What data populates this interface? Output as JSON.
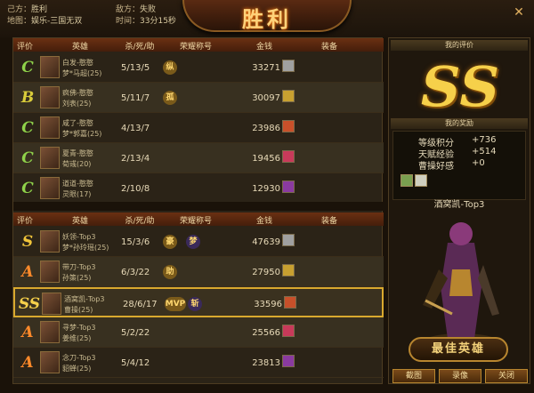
{
  "header": {
    "own_label": "己方：",
    "own_result": "胜利",
    "enemy_label": "敌方：",
    "enemy_result": "失败",
    "map_label": "地图：",
    "map_value": "娱乐-三国无双",
    "time_label": "时间：",
    "time_value": "33分15秒",
    "title": "胜利",
    "close": "✕"
  },
  "columns": {
    "rating": "评价",
    "hero": "英雄",
    "kda": "杀/死/助",
    "honor": "荣耀称号",
    "money": "金钱",
    "gear": "装备"
  },
  "columns2": {
    "rating": "评价",
    "hero": "英雄",
    "kda": "杀/死/助",
    "honor": "荣耀称号",
    "money": "金钱",
    "gear": "装备"
  },
  "team_a": [
    {
      "grade": "C",
      "grade_color": "#8fd24a",
      "name": "白发-憨憨",
      "hero": "梦*马超(25)",
      "kda": "5/13/5",
      "honors": [
        "纵"
      ],
      "money": "33271"
    },
    {
      "grade": "B",
      "grade_color": "#d9cc3a",
      "name": "疯佛-憨憨",
      "hero": "刘表(25)",
      "kda": "5/11/7",
      "honors": [
        "孤"
      ],
      "money": "30097"
    },
    {
      "grade": "C",
      "grade_color": "#8fd24a",
      "name": "咸了-憨憨",
      "hero": "梦*郭嘉(25)",
      "kda": "4/13/7",
      "honors": [],
      "money": "23986"
    },
    {
      "grade": "C",
      "grade_color": "#8fd24a",
      "name": "夏青-憨憨",
      "hero": "荀彧(20)",
      "kda": "2/13/4",
      "honors": [],
      "money": "19456"
    },
    {
      "grade": "C",
      "grade_color": "#8fd24a",
      "name": "道道-憨憨",
      "hero": "灵眼(17)",
      "kda": "2/10/8",
      "honors": [],
      "money": "12930"
    }
  ],
  "team_b": [
    {
      "grade": "S",
      "grade_color": "#f0c43a",
      "name": "妖领-Top3",
      "hero": "梦*孙玲瑶(25)",
      "kda": "15/3/6",
      "honors": [
        "豪",
        "梦"
      ],
      "money": "47639"
    },
    {
      "grade": "A",
      "grade_color": "#ff8a2a",
      "name": "带刀-Top3",
      "hero": "孙策(25)",
      "kda": "6/3/22",
      "honors": [
        "助"
      ],
      "money": "27950"
    },
    {
      "grade": "SS",
      "grade_color": "#f6d04a",
      "name": "酒窝凯-Top3",
      "hero": "曹操(25)",
      "kda": "28/6/17",
      "honors": [
        "MVP",
        "斩"
      ],
      "money": "33596"
    },
    {
      "grade": "A",
      "grade_color": "#ff8a2a",
      "name": "寻梦-Top3",
      "hero": "姜维(25)",
      "kda": "5/2/22",
      "honors": [],
      "money": "25566"
    },
    {
      "grade": "A",
      "grade_color": "#ff8a2a",
      "name": "念刀-Top3",
      "hero": "貂蝉(25)",
      "kda": "5/4/12",
      "honors": [],
      "money": "23813"
    }
  ],
  "right": {
    "my_rating_label": "我的评价",
    "my_rating": "SS",
    "reward_label": "我的奖励",
    "rewards": [
      {
        "label": "等级积分",
        "value": "+736"
      },
      {
        "label": "天赋经验",
        "value": "+514"
      },
      {
        "label": "曹操好感",
        "value": "+0"
      }
    ],
    "mvp_name": "酒窝凯-Top3",
    "best_label": "最佳英雄"
  },
  "buttons": {
    "screenshot": "截图",
    "record": "录像",
    "close": "关闭"
  },
  "colors": {
    "accent": "#d9a92e",
    "header_bar": "#6a3012"
  }
}
